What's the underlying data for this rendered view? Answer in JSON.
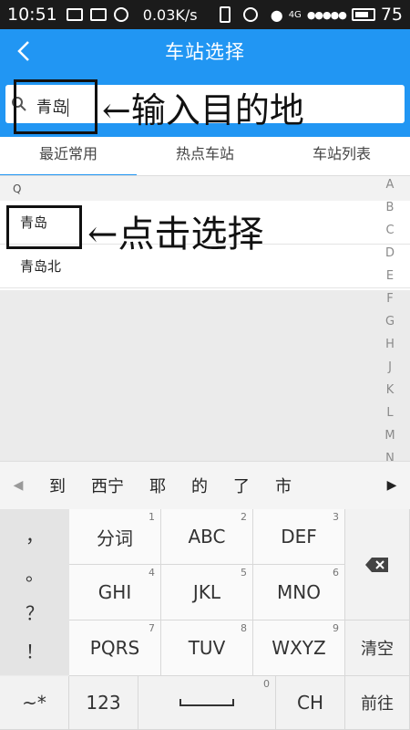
{
  "status_bar": {
    "time": "10:51",
    "net_speed": "0.03K/s",
    "network": "4G",
    "signal": "●●●●●",
    "battery_level": "75"
  },
  "header": {
    "title": "车站选择"
  },
  "search": {
    "value": "青岛"
  },
  "annotations": {
    "input_hint": "←输入目的地",
    "select_hint": "←点击选择"
  },
  "tabs": [
    {
      "label": "最近常用",
      "active": true
    },
    {
      "label": "热点车站",
      "active": false
    },
    {
      "label": "车站列表",
      "active": false
    }
  ],
  "list": {
    "section": "Q",
    "items": [
      "青岛",
      "青岛北"
    ]
  },
  "alphabet": [
    "A",
    "B",
    "C",
    "D",
    "E",
    "F",
    "G",
    "H",
    "J",
    "K",
    "L",
    "M",
    "N"
  ],
  "candidates": [
    "到",
    "西宁",
    "耶",
    "的",
    "了",
    "市"
  ],
  "keyboard": {
    "punctuation": [
      "，",
      "。",
      "？",
      "！"
    ],
    "rows": [
      [
        {
          "label": "分词",
          "num": "1"
        },
        {
          "label": "ABC",
          "num": "2"
        },
        {
          "label": "DEF",
          "num": "3"
        }
      ],
      [
        {
          "label": "GHI",
          "num": "4"
        },
        {
          "label": "JKL",
          "num": "5"
        },
        {
          "label": "MNO",
          "num": "6"
        }
      ],
      [
        {
          "label": "PQRS",
          "num": "7"
        },
        {
          "label": "TUV",
          "num": "8"
        },
        {
          "label": "WXYZ",
          "num": "9"
        }
      ]
    ],
    "clear_label": "清空",
    "symbols_label": "~*",
    "numbers_label": "123",
    "space_num": "0",
    "lang_label": "CH",
    "go_label": "前往"
  },
  "colors": {
    "primary": "#2196f3"
  }
}
